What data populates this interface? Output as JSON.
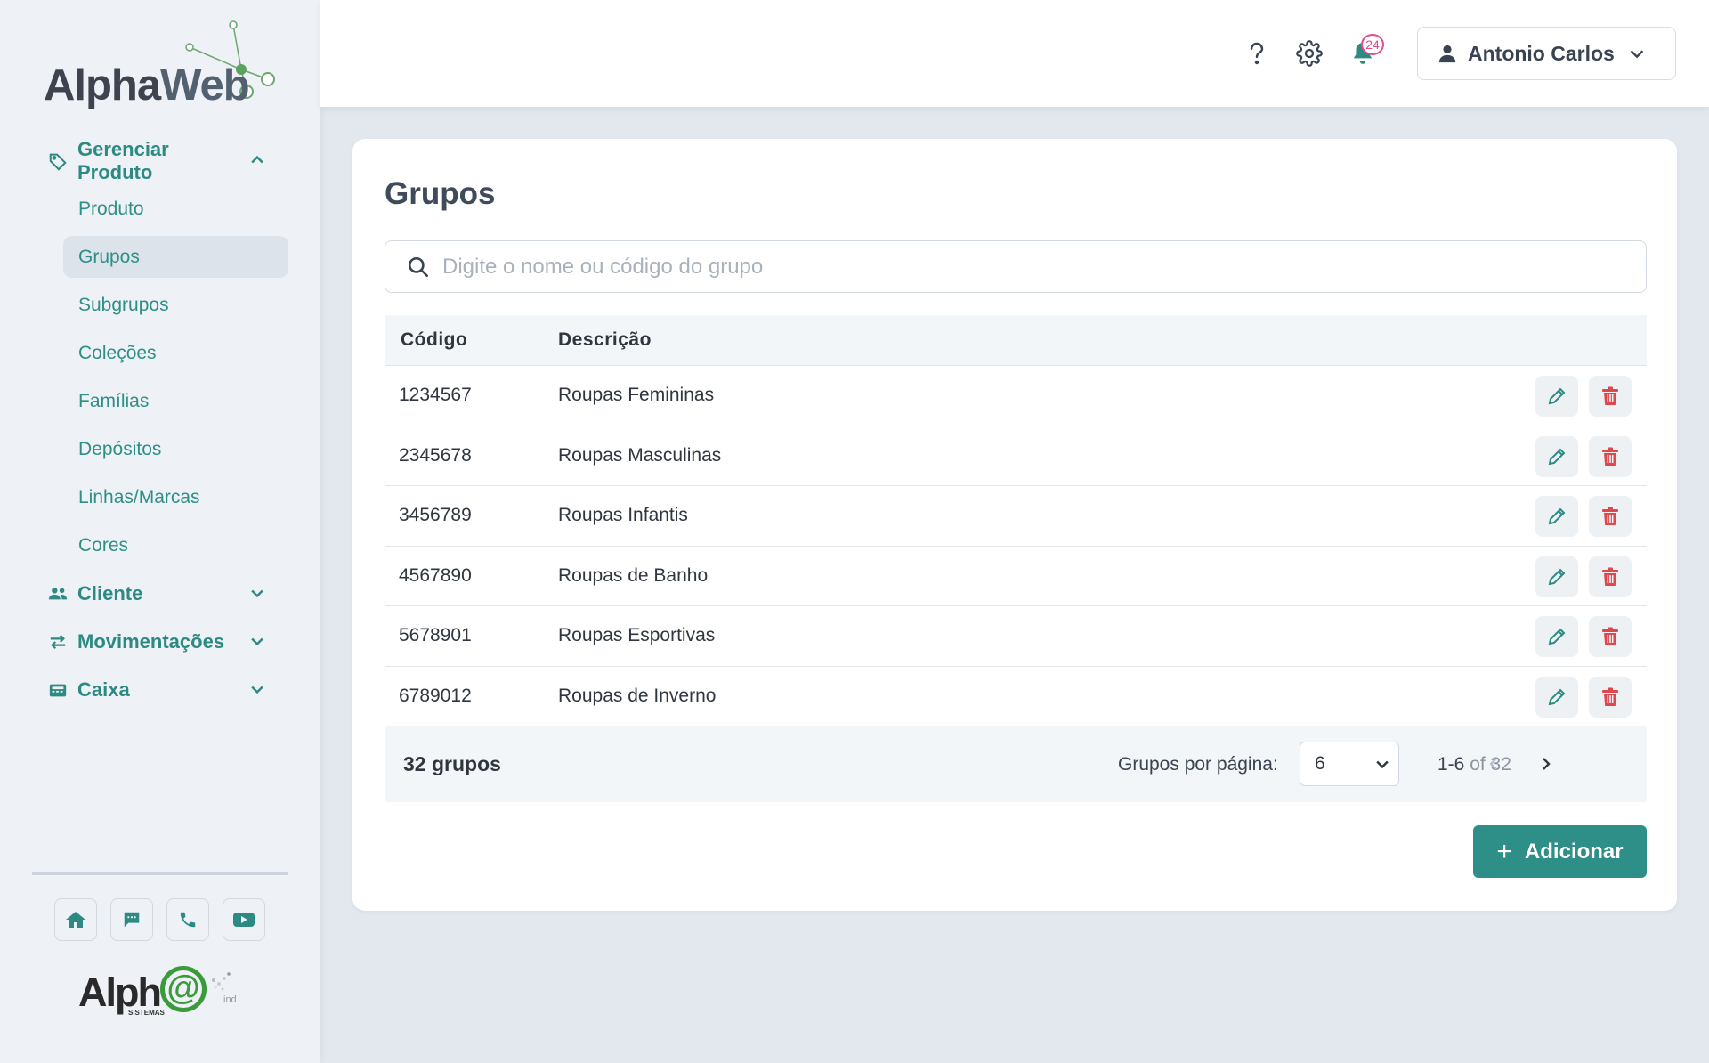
{
  "brand": {
    "alpha": "Alpha",
    "web": "Web"
  },
  "sidebar": {
    "product_group": {
      "label": "Gerenciar Produto",
      "icon": "tag-icon",
      "expanded": true
    },
    "product_items": [
      {
        "label": "Produto"
      },
      {
        "label": "Grupos",
        "active": true
      },
      {
        "label": "Subgrupos"
      },
      {
        "label": "Coleções"
      },
      {
        "label": "Famílias"
      },
      {
        "label": "Depósitos"
      },
      {
        "label": "Linhas/Marcas"
      },
      {
        "label": "Cores"
      }
    ],
    "groups": [
      {
        "label": "Cliente",
        "icon": "users-icon"
      },
      {
        "label": "Movimentações",
        "icon": "exchange-icon"
      },
      {
        "label": "Caixa",
        "icon": "cash-register-icon"
      }
    ],
    "quick_links": [
      "home-icon",
      "chat-icon",
      "phone-icon",
      "youtube-icon"
    ],
    "footer_brand": {
      "alph": "Alph",
      "at": "@",
      "sistemas": "SISTEMAS",
      "ind": "ind"
    }
  },
  "topbar": {
    "icons": [
      "help-icon",
      "settings-icon",
      "bell-icon"
    ],
    "notifications_count": "24",
    "user_name": "Antonio Carlos"
  },
  "page": {
    "title": "Grupos",
    "search_placeholder": "Digite o nome ou código do grupo",
    "columns": {
      "code": "Código",
      "description": "Descrição"
    },
    "rows": [
      {
        "code": "1234567",
        "description": "Roupas Femininas"
      },
      {
        "code": "2345678",
        "description": "Roupas Masculinas"
      },
      {
        "code": "3456789",
        "description": "Roupas Infantis"
      },
      {
        "code": "4567890",
        "description": "Roupas de Banho"
      },
      {
        "code": "5678901",
        "description": "Roupas Esportivas"
      },
      {
        "code": "6789012",
        "description": "Roupas de Inverno"
      }
    ],
    "footer": {
      "total": "32 grupos",
      "per_page_label": "Grupos por página:",
      "per_page_value": "6",
      "range": "1-6",
      "range_of": "of 32"
    },
    "add_button": {
      "plus": "+",
      "label": "Adicionar"
    }
  },
  "colors": {
    "primary": "#2d8f87",
    "danger": "#e0474c",
    "badge": "#e24c8a",
    "sidebar_bg": "#eef1f5",
    "page_bg": "#e3e8ef"
  }
}
